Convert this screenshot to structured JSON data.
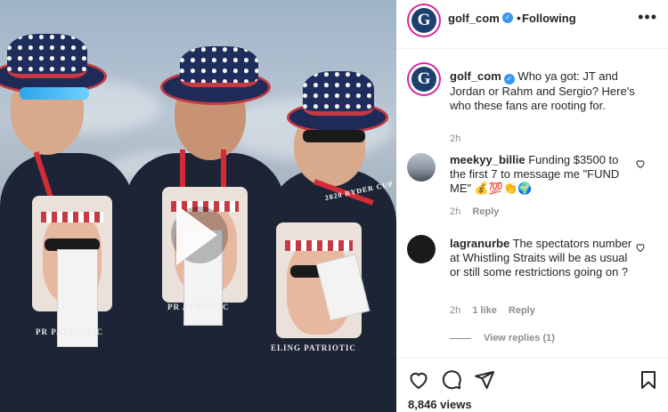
{
  "post": {
    "username": "golf_com",
    "follow_separator": "•",
    "follow_status": "Following",
    "avatar_letter": "G",
    "caption_user": "golf_com",
    "caption_text": "Who ya got: JT and Jordan or Rahm and Sergio? Here's who these fans are rooting for.",
    "caption_time": "2h",
    "views": "8,846 views",
    "media_shirt_text_1": "PR     PATRIOTIC",
    "media_shirt_text_2": "PR     ATRIOTIC",
    "media_shirt_text_3": "ELING PATRIOTIC",
    "media_lanyard_text": "2020 RYDER CUP"
  },
  "comments": [
    {
      "user": "meekyy_billie",
      "text": "Funding $3500 to the first 7 to message me \"FUND ME\" 💰💯👏🌍",
      "time": "2h",
      "likes": "",
      "reply": "Reply"
    },
    {
      "user": "lagranurbe",
      "text": "The spectators number at Whistling Straits will be as usual or still some restrictions going on ?",
      "time": "2h",
      "likes": "1 like",
      "reply": "Reply"
    }
  ],
  "view_replies": "View replies (1)",
  "icons": [
    "more-options-icon",
    "verified-badge-icon",
    "heart-icon",
    "comment-icon",
    "share-icon",
    "bookmark-icon",
    "play-icon"
  ],
  "colors": {
    "accent_ring": "#d6249f",
    "verified": "#3897f0",
    "muted": "#8e8e8e"
  }
}
